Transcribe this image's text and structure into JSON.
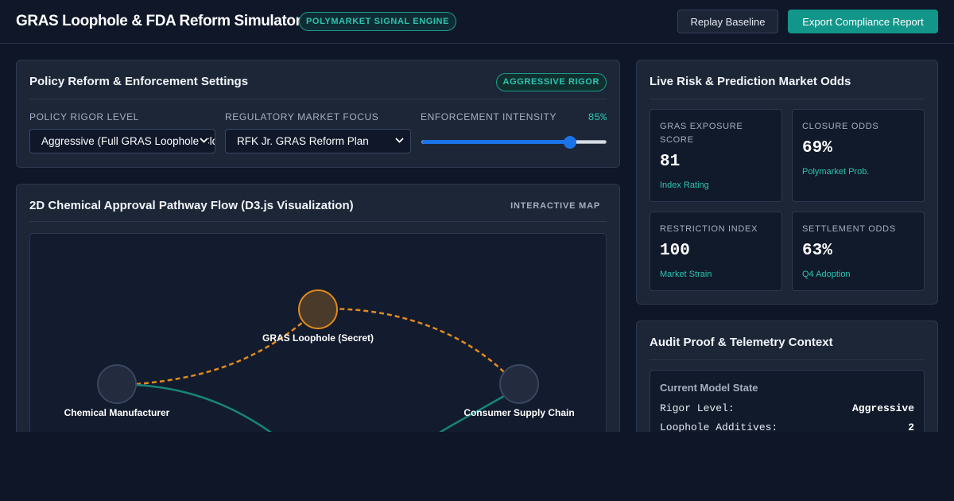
{
  "header": {
    "title": "GRAS Loophole & FDA Reform Simulator",
    "badge": "POLYMARKET SIGNAL ENGINE",
    "replay_label": "Replay Baseline",
    "export_label": "Export Compliance Report"
  },
  "settings": {
    "title": "Policy Reform & Enforcement Settings",
    "rigor_badge": "AGGRESSIVE RIGOR",
    "rigor_label": "POLICY RIGOR LEVEL",
    "rigor_value": "Aggressive (Full GRAS Loophole Closure)",
    "focus_label": "REGULATORY MARKET FOCUS",
    "focus_value": "RFK Jr. GRAS Reform Plan",
    "intensity_label": "ENFORCEMENT INTENSITY",
    "intensity_value": "85%",
    "intensity_level": 0.8
  },
  "pathway": {
    "title": "2D Chemical Approval Pathway Flow (D3.js Visualization)",
    "map_label": "INTERACTIVE MAP",
    "nodes": {
      "gras": "GRAS Loophole (Secret)",
      "manufacturer": "Chemical Manufacturer",
      "consumer": "Consumer Supply Chain"
    },
    "colors": {
      "loophole_path": "#e08a1e",
      "approved_path": "#17857a"
    }
  },
  "risk": {
    "title": "Live Risk & Prediction Market Odds",
    "metrics": [
      {
        "label": "GRAS EXPOSURE SCORE",
        "value": "81",
        "sub": "Index Rating"
      },
      {
        "label": "CLOSURE ODDS",
        "value": "69%",
        "sub": "Polymarket Prob."
      },
      {
        "label": "RESTRICTION INDEX",
        "value": "100",
        "sub": "Market Strain"
      },
      {
        "label": "SETTLEMENT ODDS",
        "value": "63%",
        "sub": "Q4 Adoption"
      }
    ]
  },
  "audit": {
    "title": "Audit Proof & Telemetry Context",
    "state_title": "Current Model State",
    "rows": [
      {
        "key": "Rigor Level:",
        "value": "Aggressive"
      },
      {
        "key": "Loophole Additives:",
        "value": "2"
      }
    ]
  },
  "colors": {
    "accent": "#2ec4b0",
    "primary_button": "#13968a",
    "background": "#0e1627"
  }
}
